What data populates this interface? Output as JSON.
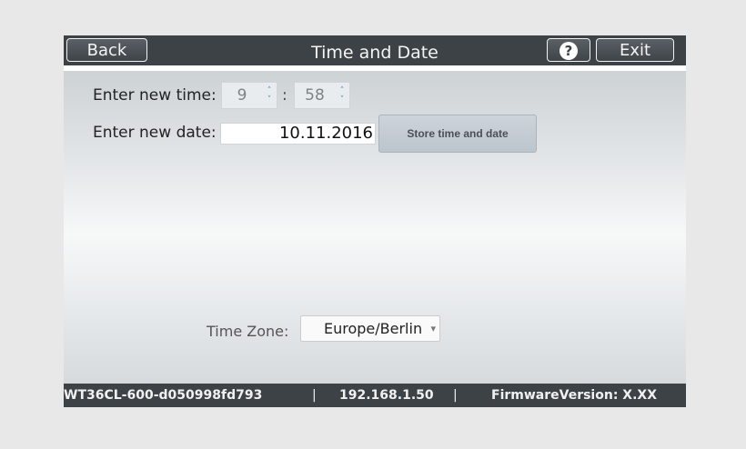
{
  "header": {
    "back_label": "Back",
    "title": "Time and Date",
    "help_symbol": "?",
    "exit_label": "Exit"
  },
  "time": {
    "label": "Enter new time:",
    "hour": "9",
    "separator": ":",
    "minute": "58"
  },
  "date": {
    "label": "Enter new date:",
    "value": "10.11.2016",
    "store_label": "Store time and date"
  },
  "timezone": {
    "label": "Time Zone:",
    "selected": "Europe/Berlin",
    "arrow": "▾"
  },
  "footer": {
    "device_id": "WT36CL-600-d050998fd793",
    "separator": "|",
    "ip": "192.168.1.50",
    "firmware": "FirmwareVersion: X.XX"
  },
  "icons": {
    "help": "help-icon",
    "spinner": "spinner-arrows-icon",
    "dropdown": "chevron-down-icon"
  },
  "colors": {
    "header_bg": "#3c4246",
    "footer_bg": "#3c4246",
    "accent_arrows": "#4d8fc7"
  }
}
